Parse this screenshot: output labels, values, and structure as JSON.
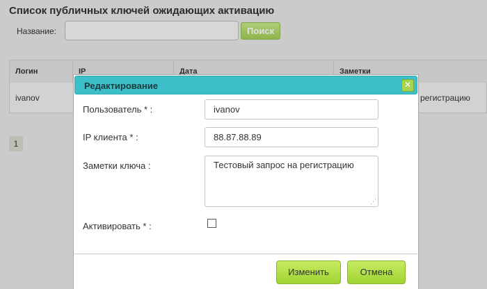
{
  "page": {
    "title": "Список публичных ключей ожидающих активацию",
    "search": {
      "label": "Название:",
      "value": "",
      "placeholder": "",
      "button_label": "Поиск"
    }
  },
  "table": {
    "columns": [
      "Логин",
      "IP",
      "Дата",
      "Заметки"
    ],
    "rows": [
      {
        "login": "ivanov",
        "notes_visible": "регистрацию"
      }
    ]
  },
  "pagination": {
    "current": "1"
  },
  "dialog": {
    "title": "Редактирование",
    "close_icon": "close-icon",
    "fields": {
      "user": {
        "label": "Пользователь * :",
        "value": "ivanov"
      },
      "ip": {
        "label": "IP клиента * :",
        "value": "88.87.88.89"
      },
      "notes": {
        "label": "Заметки ключа :",
        "value": "Тестовый запрос на регистрацию"
      },
      "activate": {
        "label": "Активировать * :",
        "checked": false
      }
    },
    "buttons": {
      "save": "Изменить",
      "cancel": "Отмена"
    }
  },
  "colors": {
    "header": "#3cbfc9",
    "accent_green": "#a3cf57"
  }
}
